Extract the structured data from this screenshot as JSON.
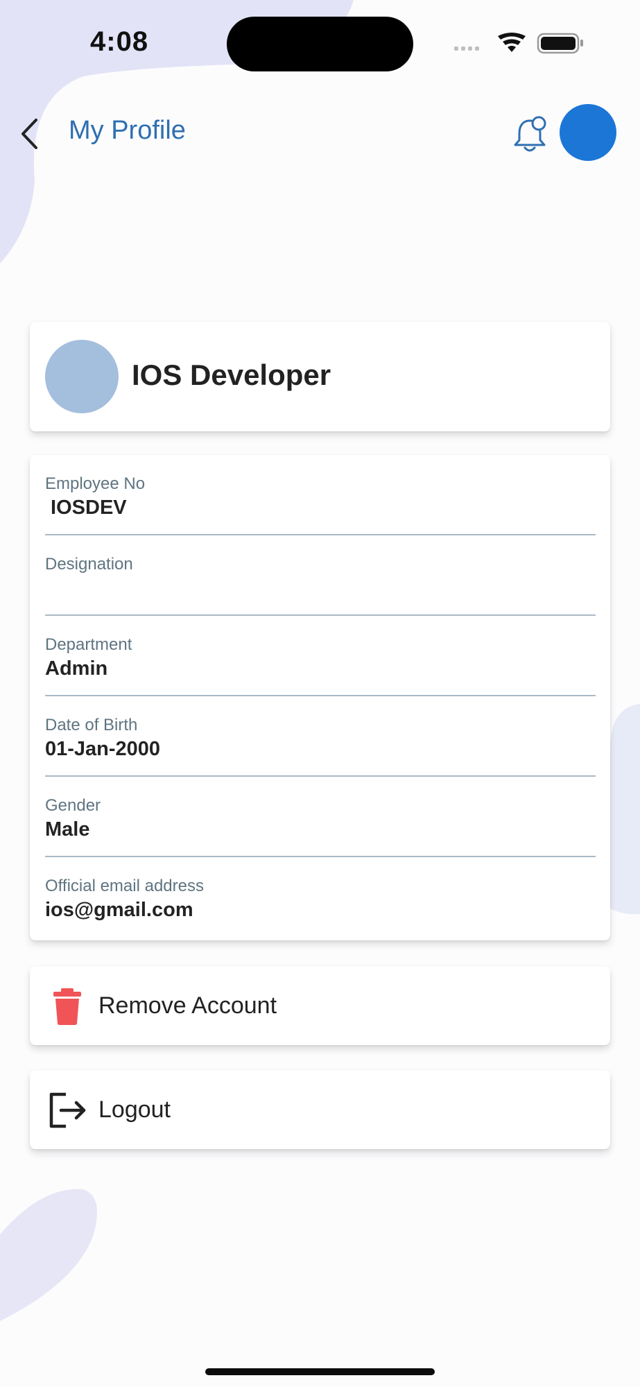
{
  "status_bar": {
    "time": "4:08"
  },
  "header": {
    "title": "My Profile"
  },
  "profile": {
    "name": "IOS Developer"
  },
  "fields": [
    {
      "label": "Employee No",
      "value": " IOSDEV"
    },
    {
      "label": "Designation",
      "value": ""
    },
    {
      "label": "Department",
      "value": "Admin"
    },
    {
      "label": "Date of Birth",
      "value": "01-Jan-2000"
    },
    {
      "label": "Gender",
      "value": "Male"
    },
    {
      "label": "Official email address",
      "value": "ios@gmail.com"
    }
  ],
  "actions": {
    "remove_account": "Remove Account",
    "logout": "Logout"
  },
  "icons": {
    "back": "chevron-left-icon",
    "notifications": "bell-icon",
    "remove": "trash-icon",
    "logout": "logout-icon"
  },
  "colors": {
    "accent": "#2f6fb0",
    "avatar_top": "#1c76d6",
    "profile_avatar": "#a4bedd",
    "danger": "#f05456"
  }
}
